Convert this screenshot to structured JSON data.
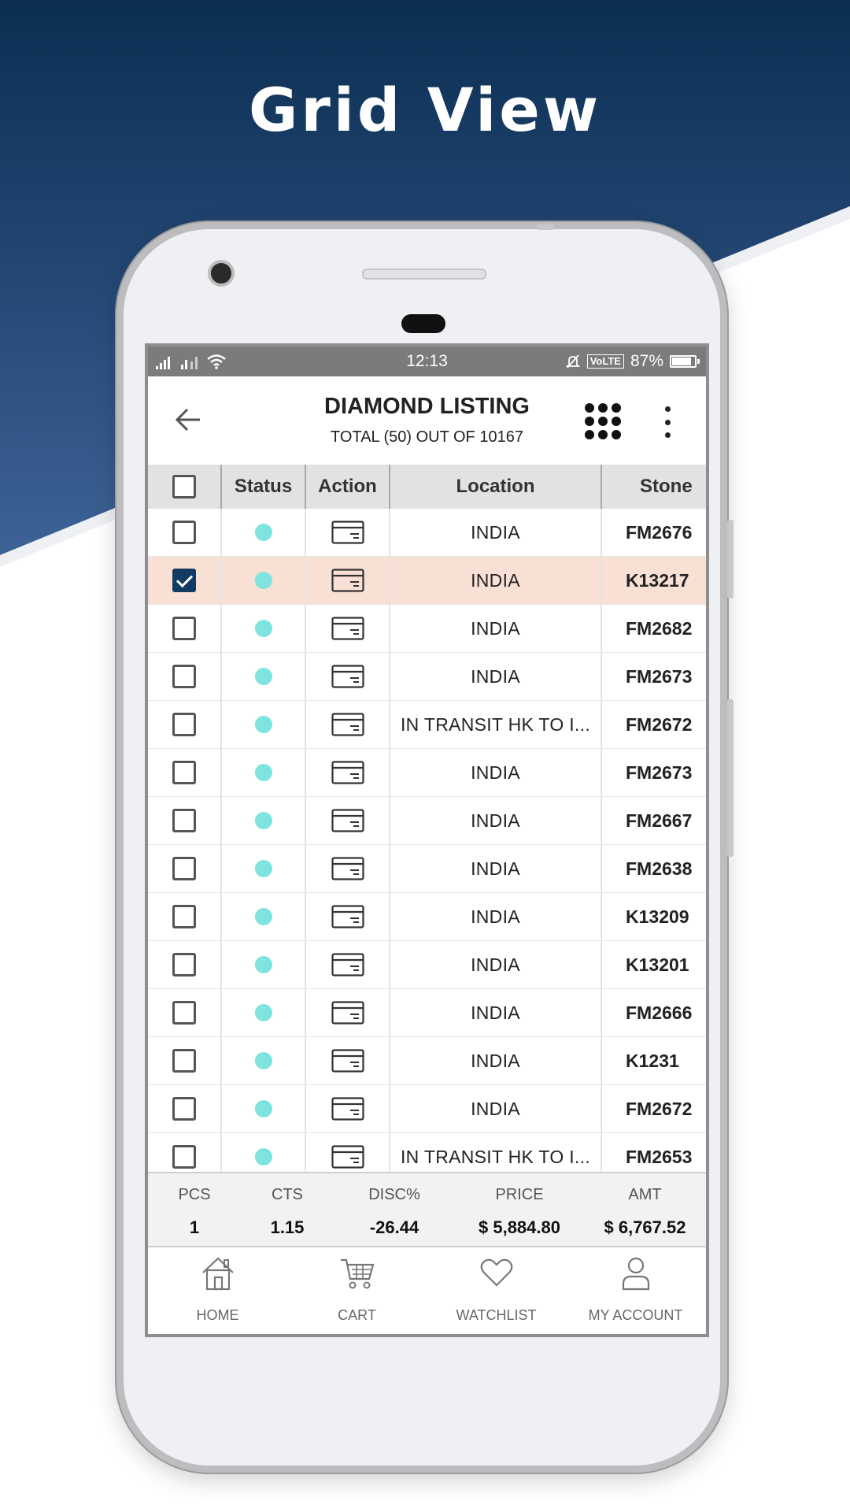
{
  "headline": "Grid View",
  "status_bar": {
    "time": "12:13",
    "volte": "VoLTE",
    "battery": "87%"
  },
  "app_bar": {
    "title": "DIAMOND LISTING",
    "subtitle": "TOTAL (50) OUT OF 10167",
    "back_icon": "back-arrow-icon",
    "grid_icon": "grid-view-icon",
    "more_icon": "more-vert-icon"
  },
  "table": {
    "headers": {
      "status": "Status",
      "action": "Action",
      "location": "Location",
      "stone": "Stone"
    },
    "status_color": "#7fe3e0",
    "selected_color": "#f9e0d4",
    "rows": [
      {
        "checked": false,
        "location": "INDIA",
        "stone": "FM2676"
      },
      {
        "checked": true,
        "location": "INDIA",
        "stone": "K13217"
      },
      {
        "checked": false,
        "location": "INDIA",
        "stone": "FM2682"
      },
      {
        "checked": false,
        "location": "INDIA",
        "stone": "FM2673"
      },
      {
        "checked": false,
        "location": "IN TRANSIT HK TO I...",
        "stone": "FM2672"
      },
      {
        "checked": false,
        "location": "INDIA",
        "stone": "FM2673"
      },
      {
        "checked": false,
        "location": "INDIA",
        "stone": "FM2667"
      },
      {
        "checked": false,
        "location": "INDIA",
        "stone": "FM2638"
      },
      {
        "checked": false,
        "location": "INDIA",
        "stone": "K13209"
      },
      {
        "checked": false,
        "location": "INDIA",
        "stone": "K13201"
      },
      {
        "checked": false,
        "location": "INDIA",
        "stone": "FM2666"
      },
      {
        "checked": false,
        "location": "INDIA",
        "stone": "K1231"
      },
      {
        "checked": false,
        "location": "INDIA",
        "stone": "FM2672"
      },
      {
        "checked": false,
        "location": "IN TRANSIT HK TO I...",
        "stone": "FM2653"
      }
    ]
  },
  "summary": {
    "labels": {
      "pcs": "PCS",
      "cts": "CTS",
      "disc": "DISC%",
      "price": "PRICE",
      "amt": "AMT"
    },
    "values": {
      "pcs": "1",
      "cts": "1.15",
      "disc": "-26.44",
      "price": "$ 5,884.80",
      "amt": "$ 6,767.52"
    }
  },
  "bottom_nav": [
    {
      "label": "HOME",
      "icon": "home-icon"
    },
    {
      "label": "CART",
      "icon": "cart-icon"
    },
    {
      "label": "WATCHLIST",
      "icon": "heart-icon"
    },
    {
      "label": "MY ACCOUNT",
      "icon": "user-icon"
    }
  ],
  "colors": {
    "header_bg_top": "#0b2e52",
    "header_bg_bottom": "#3d6296",
    "checkbox_checked": "#123a63"
  }
}
